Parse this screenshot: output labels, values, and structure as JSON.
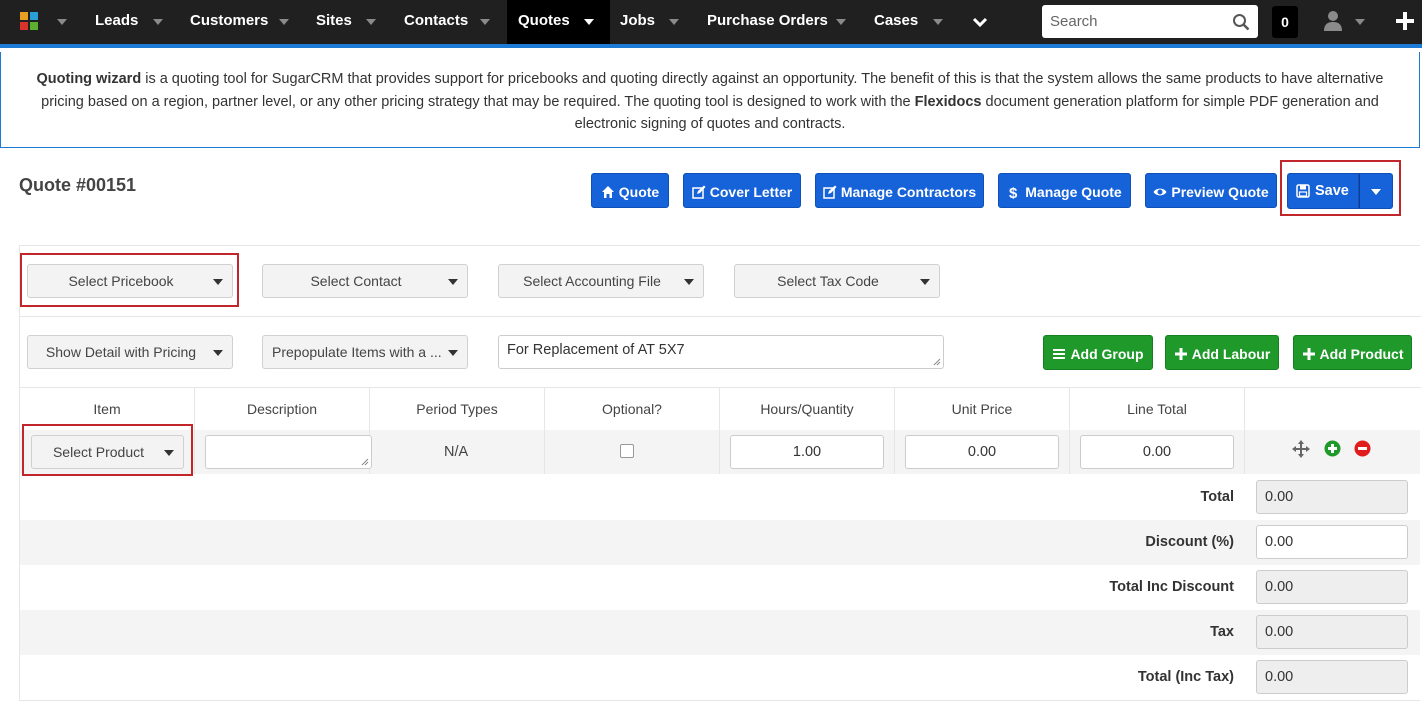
{
  "nav": {
    "items": [
      {
        "label": "Leads",
        "active": false
      },
      {
        "label": "Customers",
        "active": false
      },
      {
        "label": "Sites",
        "active": false
      },
      {
        "label": "Contacts",
        "active": false
      },
      {
        "label": "Quotes",
        "active": true
      },
      {
        "label": "Jobs",
        "active": false
      },
      {
        "label": "Purchase Orders",
        "active": false
      },
      {
        "label": "Cases",
        "active": false
      }
    ],
    "search_placeholder": "Search",
    "notification_count": "0",
    "colors": {
      "bar": "#202020",
      "accent": "#1d7ad6"
    }
  },
  "info": {
    "bold1": "Quoting wizard",
    "text1": " is a quoting tool for SugarCRM that provides support for pricebooks and quoting directly against an opportunity. The benefit of this is that the system allows the same products to have alternative pricing based on a region, partner level, or any other pricing strategy that may be required. The quoting tool is designed to work with the ",
    "bold2": "Flexidocs",
    "text2": " document generation platform for simple PDF generation and electronic signing of quotes and contracts."
  },
  "quote": {
    "title": "Quote #00151",
    "buttons": {
      "quote": "Quote",
      "cover_letter": "Cover Letter",
      "manage_contractors": "Manage Contractors",
      "manage_quote": "Manage Quote",
      "preview_quote": "Preview Quote",
      "save": "Save"
    }
  },
  "filters": {
    "pricebook": "Select Pricebook",
    "contact": "Select Contact",
    "accounting_file": "Select Accounting File",
    "tax_code": "Select Tax Code",
    "detail": "Show Detail with Pricing",
    "prepopulate": "Prepopulate Items with a ...",
    "notes": "For Replacement of AT 5X7"
  },
  "actions": {
    "add_group": "Add Group",
    "add_labour": "Add Labour",
    "add_product": "Add Product"
  },
  "table": {
    "headers": [
      "Item",
      "Description",
      "Period Types",
      "Optional?",
      "Hours/Quantity",
      "Unit Price",
      "Line Total"
    ],
    "row": {
      "product": "Select Product",
      "description": "",
      "period_type": "N/A",
      "optional": false,
      "quantity": "1.00",
      "unit_price": "0.00",
      "line_total": "0.00"
    }
  },
  "totals": [
    {
      "label": "Total",
      "value": "0.00",
      "editable": false
    },
    {
      "label": "Discount (%)",
      "value": "0.00",
      "editable": true
    },
    {
      "label": "Total Inc Discount",
      "value": "0.00",
      "editable": false
    },
    {
      "label": "Tax",
      "value": "0.00",
      "editable": false
    },
    {
      "label": "Total (Inc Tax)",
      "value": "0.00",
      "editable": false
    }
  ],
  "colors": {
    "primary_button": "#1662d8",
    "success_button": "#1f9a2a",
    "highlight": "#c1262a"
  }
}
